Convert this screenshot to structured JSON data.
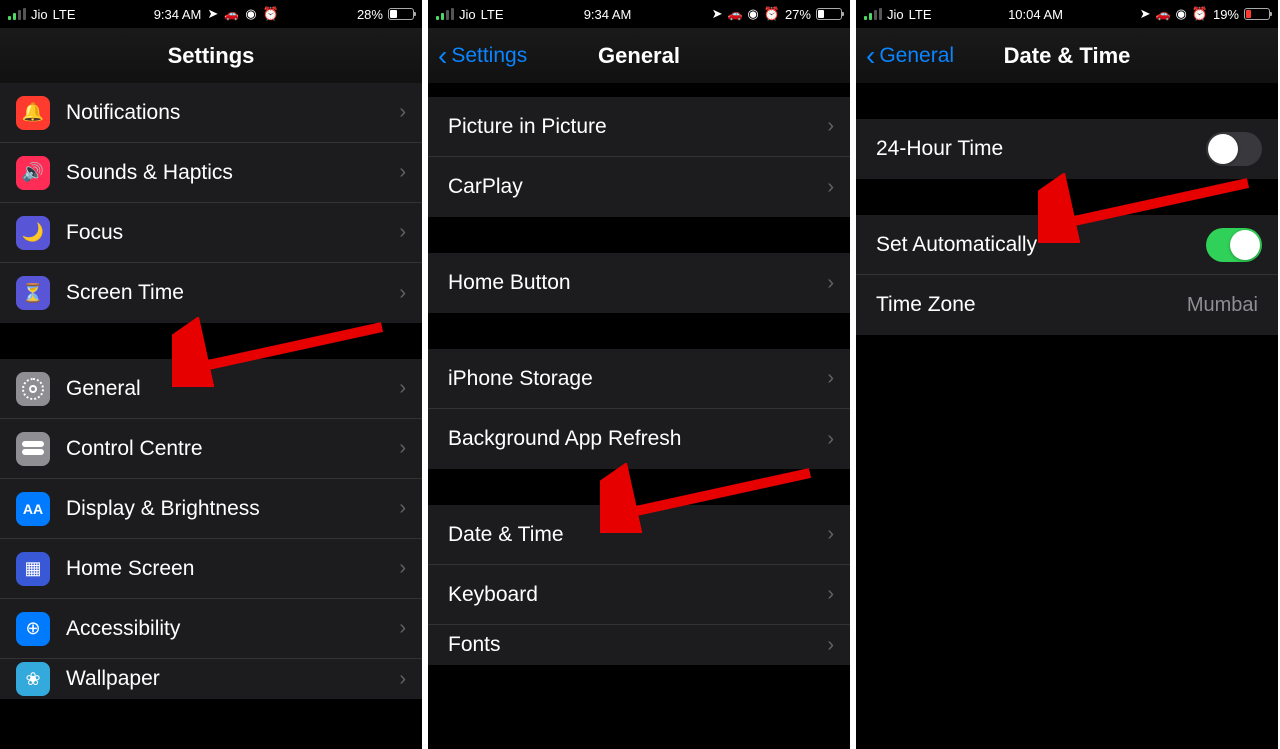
{
  "phones": [
    {
      "status": {
        "carrier": "Jio",
        "network": "LTE",
        "time": "9:34 AM",
        "battery_pct": "28%",
        "battery_level": 28,
        "battery_low": false
      },
      "nav": {
        "title": "Settings",
        "back": null
      },
      "groups": [
        {
          "type": "list",
          "rows": [
            {
              "icon": "ic-notif",
              "glyph": "🔔",
              "label": "Notifications",
              "chevron": true
            },
            {
              "icon": "ic-sound",
              "glyph": "🔊",
              "label": "Sounds & Haptics",
              "chevron": true
            },
            {
              "icon": "ic-focus",
              "glyph": "🌙",
              "label": "Focus",
              "chevron": true
            },
            {
              "icon": "ic-screen",
              "glyph": "⏳",
              "label": "Screen Time",
              "chevron": true
            }
          ]
        },
        {
          "type": "gap"
        },
        {
          "type": "list",
          "rows": [
            {
              "icon": "ic-general",
              "glyph": "gear",
              "label": "General",
              "chevron": true,
              "arrow": true
            },
            {
              "icon": "ic-control",
              "glyph": "toggle",
              "label": "Control Centre",
              "chevron": true
            },
            {
              "icon": "ic-display",
              "glyph": "AA",
              "label": "Display & Brightness",
              "chevron": true
            },
            {
              "icon": "ic-home",
              "glyph": "▦",
              "label": "Home Screen",
              "chevron": true
            },
            {
              "icon": "ic-acc",
              "glyph": "⊕",
              "label": "Accessibility",
              "chevron": true
            },
            {
              "icon": "ic-wall",
              "glyph": "❀",
              "label": "Wallpaper",
              "chevron": true,
              "cut": true
            }
          ]
        }
      ]
    },
    {
      "status": {
        "carrier": "Jio",
        "network": "LTE",
        "time": "9:34 AM",
        "battery_pct": "27%",
        "battery_level": 27,
        "battery_low": false
      },
      "nav": {
        "title": "General",
        "back": "Settings"
      },
      "groups": [
        {
          "type": "gap-small"
        },
        {
          "type": "list",
          "rows": [
            {
              "label": "Picture in Picture",
              "chevron": true
            },
            {
              "label": "CarPlay",
              "chevron": true
            }
          ]
        },
        {
          "type": "gap"
        },
        {
          "type": "list",
          "rows": [
            {
              "label": "Home Button",
              "chevron": true
            }
          ]
        },
        {
          "type": "gap"
        },
        {
          "type": "list",
          "rows": [
            {
              "label": "iPhone Storage",
              "chevron": true
            },
            {
              "label": "Background App Refresh",
              "chevron": true
            }
          ]
        },
        {
          "type": "gap"
        },
        {
          "type": "list",
          "rows": [
            {
              "label": "Date & Time",
              "chevron": true,
              "arrow": true
            },
            {
              "label": "Keyboard",
              "chevron": true
            },
            {
              "label": "Fonts",
              "chevron": true,
              "cut": true
            }
          ]
        }
      ]
    },
    {
      "status": {
        "carrier": "Jio",
        "network": "LTE",
        "time": "10:04 AM",
        "battery_pct": "19%",
        "battery_level": 19,
        "battery_low": true
      },
      "nav": {
        "title": "Date & Time",
        "back": "General"
      },
      "groups": [
        {
          "type": "gap"
        },
        {
          "type": "list",
          "rows": [
            {
              "label": "24-Hour Time",
              "switch": "off"
            }
          ]
        },
        {
          "type": "gap"
        },
        {
          "type": "list",
          "rows": [
            {
              "label": "Set Automatically",
              "switch": "on",
              "arrow": true
            },
            {
              "label": "Time Zone",
              "value": "Mumbai"
            }
          ]
        }
      ]
    }
  ],
  "icons_status": [
    "location",
    "car",
    "target",
    "alarm"
  ]
}
